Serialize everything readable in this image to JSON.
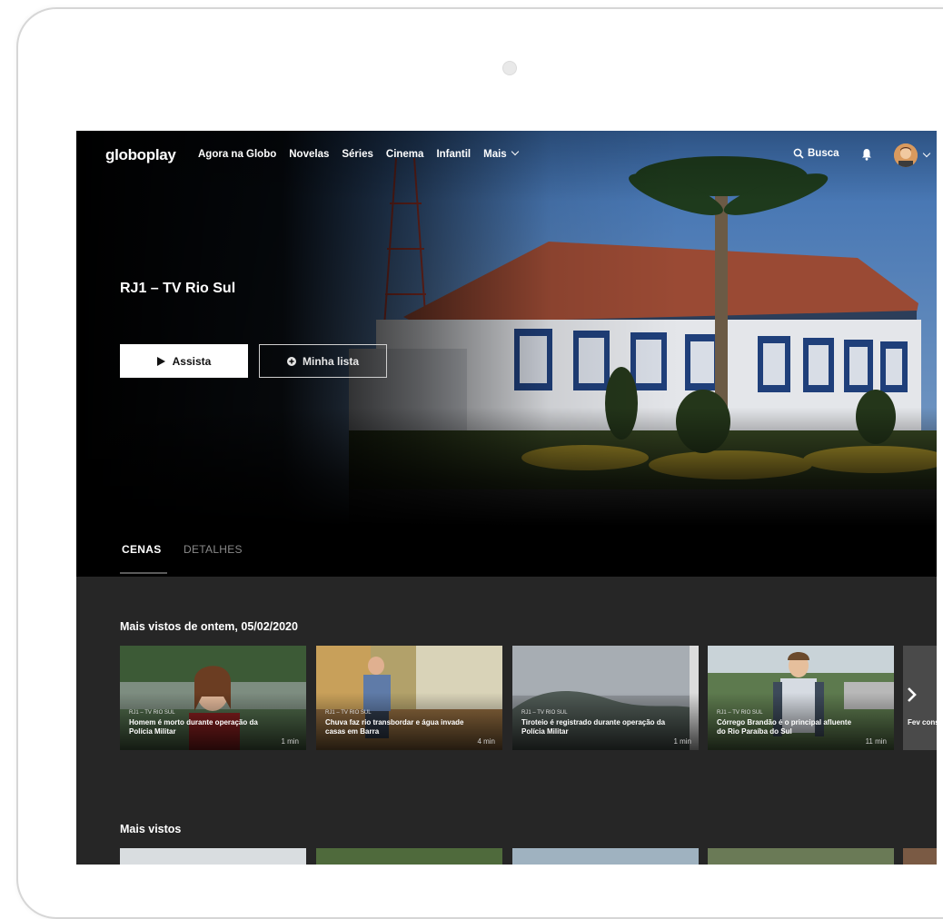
{
  "app": {
    "logo": "globoplay"
  },
  "nav": {
    "items": [
      "Agora na Globo",
      "Novelas",
      "Séries",
      "Cinema",
      "Infantil",
      "Mais"
    ],
    "search_label": "Busca"
  },
  "hero": {
    "title": "RJ1 – TV Rio Sul",
    "play_label": "Assista",
    "mylist_label": "Minha lista"
  },
  "tabs": [
    {
      "label": "CENAS",
      "active": true
    },
    {
      "label": "DETALHES",
      "active": false
    }
  ],
  "sections": [
    {
      "title": "Mais vistos de ontem, 05/02/2020",
      "cards": [
        {
          "tag": "RJ1 – TV RIO SUL",
          "caption": "Homem é morto durante operação da Polícia Militar",
          "duration": "1 min"
        },
        {
          "tag": "RJ1 – TV RIO SUL",
          "caption": "Chuva faz rio transbordar e água invade casas em Barra",
          "duration": "4 min"
        },
        {
          "tag": "RJ1 – TV RIO SUL",
          "caption": "Tiroteio é registrado durante operação da Polícia Militar",
          "duration": "1 min"
        },
        {
          "tag": "RJ1 – TV RIO SUL",
          "caption": "Córrego Brandão é o principal afluente do Rio Paraíba do Sul",
          "duration": "11 min"
        }
      ],
      "peek_caption": "Fev cons"
    },
    {
      "title": "Mais vistos"
    }
  ],
  "colors": {
    "screen_bg": "#262626",
    "tab_bar": "#000000",
    "text": "#ffffff"
  }
}
